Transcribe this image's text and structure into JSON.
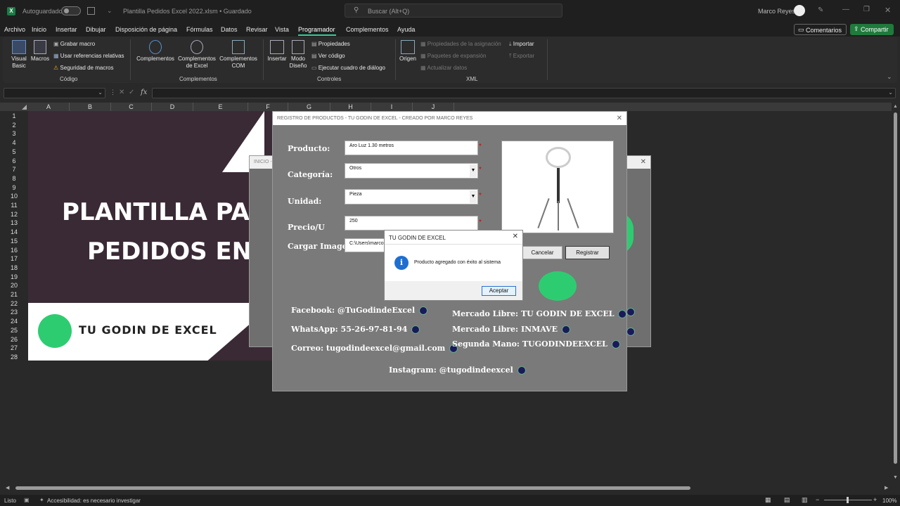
{
  "titlebar": {
    "autosave": "Autoguardado",
    "filename": "Plantilla Pedidos Excel 2022.xlsm • Guardado",
    "search": "Buscar (Alt+Q)",
    "user": "Marco Reyes"
  },
  "menu": [
    "Archivo",
    "Inicio",
    "Insertar",
    "Dibujar",
    "Disposición de página",
    "Fórmulas",
    "Datos",
    "Revisar",
    "Vista",
    "Programador",
    "Complementos",
    "Ayuda"
  ],
  "actions": {
    "comments": "Comentarios",
    "share": "Compartir"
  },
  "ribbon": {
    "codigo": {
      "visual_basic": "Visual Basic",
      "macros": "Macros",
      "grabar": "Grabar macro",
      "relativas": "Usar referencias relativas",
      "seguridad": "Seguridad de macros",
      "label": "Código"
    },
    "complementos": {
      "c1": "Complementos",
      "c2": "Complementos de Excel",
      "c3": "Complementos COM",
      "label": "Complementos"
    },
    "controles": {
      "insertar": "Insertar",
      "modo": "Modo Diseño",
      "propiedades": "Propiedades",
      "ver_codigo": "Ver código",
      "ejecutar": "Ejecutar cuadro de diálogo",
      "label": "Controles"
    },
    "xml": {
      "origen": "Origen",
      "prop_asig": "Propiedades de la asignación",
      "paquetes": "Paquetes de expansión",
      "actualizar": "Actualizar datos",
      "importar": "Importar",
      "exportar": "Exportar",
      "label": "XML"
    }
  },
  "columns": [
    "A",
    "B",
    "C",
    "D",
    "E",
    "F",
    "G",
    "H",
    "I",
    "J"
  ],
  "rows": [
    "1",
    "2",
    "3",
    "4",
    "5",
    "6",
    "7",
    "8",
    "9",
    "10",
    "11",
    "12",
    "13",
    "14",
    "15",
    "16",
    "17",
    "18",
    "19",
    "20",
    "21",
    "22",
    "23",
    "24",
    "25",
    "26",
    "27",
    "28"
  ],
  "sheet": {
    "line1": "PLANTILLA PARA",
    "line2": "PEDIDOS EN E",
    "brand": "TU GODIN DE EXCEL"
  },
  "bg_dialog": {
    "title": "INICIO -"
  },
  "form": {
    "title": "REGISTRO DE PRODUCTOS - TU GODIN DE EXCEL - CREADO POR MARCO REYES",
    "producto_label": "Producto:",
    "producto_value": "Aro Luz 1.30 metros",
    "categoria_label": "Categoría:",
    "categoria_value": "Otros",
    "unidad_label": "Unidad:",
    "unidad_value": "Pieza",
    "precio_label": "Precio/U",
    "precio_value": "250",
    "imagen_label": "Cargar Imagen",
    "imagen_value": "C:\\Users\\marco",
    "cancel": "Cancelar",
    "register": "Registrar",
    "facebook": "Facebook: @TuGodindeExcel",
    "whatsapp": "WhatsApp: 55-26-97-81-94",
    "correo": "Correo: tugodindeexcel@gmail.com",
    "mercado": "Mercado Libre: TU GODIN DE EXCEL",
    "mercado2": "Mercado Libre: INMAVE",
    "segunda": "Segunda Mano: TUGODINDEEXCEL",
    "instagram": "Instagram: @tugodindeexcel"
  },
  "msgbox": {
    "title": "TU GODIN DE EXCEL",
    "text": "Producto agregado con éxito al sistema",
    "ok": "Aceptar"
  },
  "status": {
    "ready": "Listo",
    "access": "Accesibilidad: es necesario investigar",
    "zoom": "100%"
  }
}
